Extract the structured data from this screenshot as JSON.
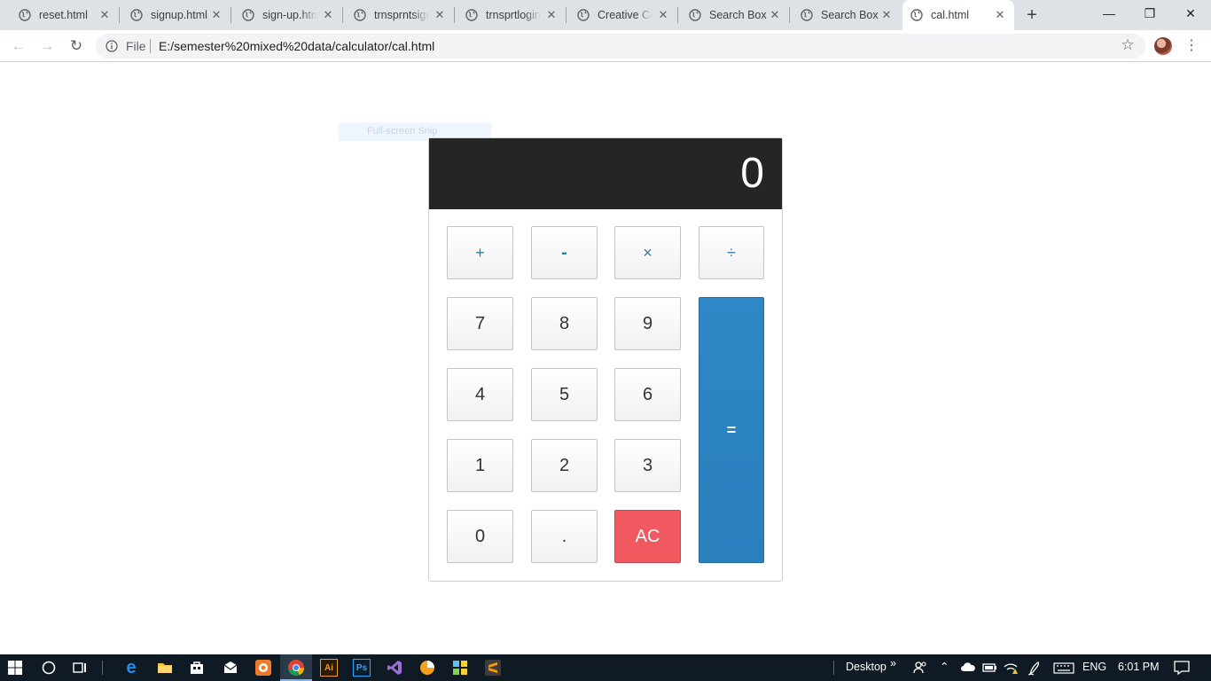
{
  "browser": {
    "tabs": [
      {
        "title": "reset.html"
      },
      {
        "title": "signup.html"
      },
      {
        "title": "sign-up.htm"
      },
      {
        "title": "trnsprntsign"
      },
      {
        "title": "trnsprtlogin"
      },
      {
        "title": "Creative Co"
      },
      {
        "title": "Search Box"
      },
      {
        "title": "Search Box"
      },
      {
        "title": "cal.html"
      }
    ],
    "address": {
      "scheme_label": "File",
      "url": "E:/semester%20mixed%20data/calculator/cal.html"
    }
  },
  "overlay": {
    "snip_label": "Full-screen Snip"
  },
  "calculator": {
    "display": "0",
    "keys": {
      "plus": "+",
      "minus": "-",
      "multiply": "×",
      "divide": "÷",
      "seven": "7",
      "eight": "8",
      "nine": "9",
      "four": "4",
      "five": "5",
      "six": "6",
      "one": "1",
      "two": "2",
      "three": "3",
      "zero": "0",
      "decimal": ".",
      "clear": "AC",
      "equals": "="
    },
    "colors": {
      "screen": "#252525",
      "equals": "#2f87c6",
      "clear": "#f0595f",
      "operator_text": "#337cac"
    }
  },
  "taskbar": {
    "desktop_label": "Desktop",
    "language": "ENG",
    "time": "6:01 PM"
  }
}
